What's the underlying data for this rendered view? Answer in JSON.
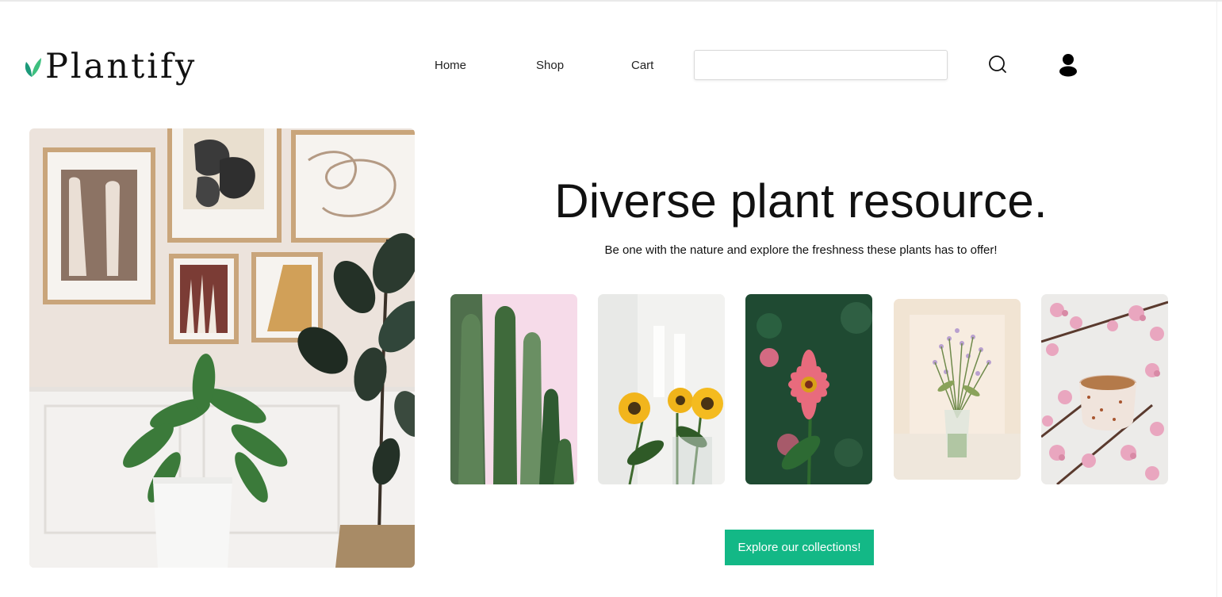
{
  "brand": {
    "name": "Plantify",
    "accent": "#2aa876"
  },
  "nav": {
    "items": [
      {
        "label": "Home"
      },
      {
        "label": "Shop"
      },
      {
        "label": "Cart"
      }
    ]
  },
  "search": {
    "placeholder": "",
    "value": "",
    "icon": "search-icon"
  },
  "account": {
    "icon": "user-icon"
  },
  "hero": {
    "image": "plants-and-wall-art-photo",
    "title": "Diverse plant resource.",
    "subtitle": "Be one with the nature and explore the freshness these plants has to offer!"
  },
  "gallery": [
    {
      "subject": "cactus-photo"
    },
    {
      "subject": "sunflowers-photo"
    },
    {
      "subject": "pink-zinnia-photo"
    },
    {
      "subject": "wildflower-vase-photo"
    },
    {
      "subject": "cherry-blossom-tea-photo"
    }
  ],
  "cta": {
    "label": "Explore our collections!",
    "color": "#13b886"
  }
}
